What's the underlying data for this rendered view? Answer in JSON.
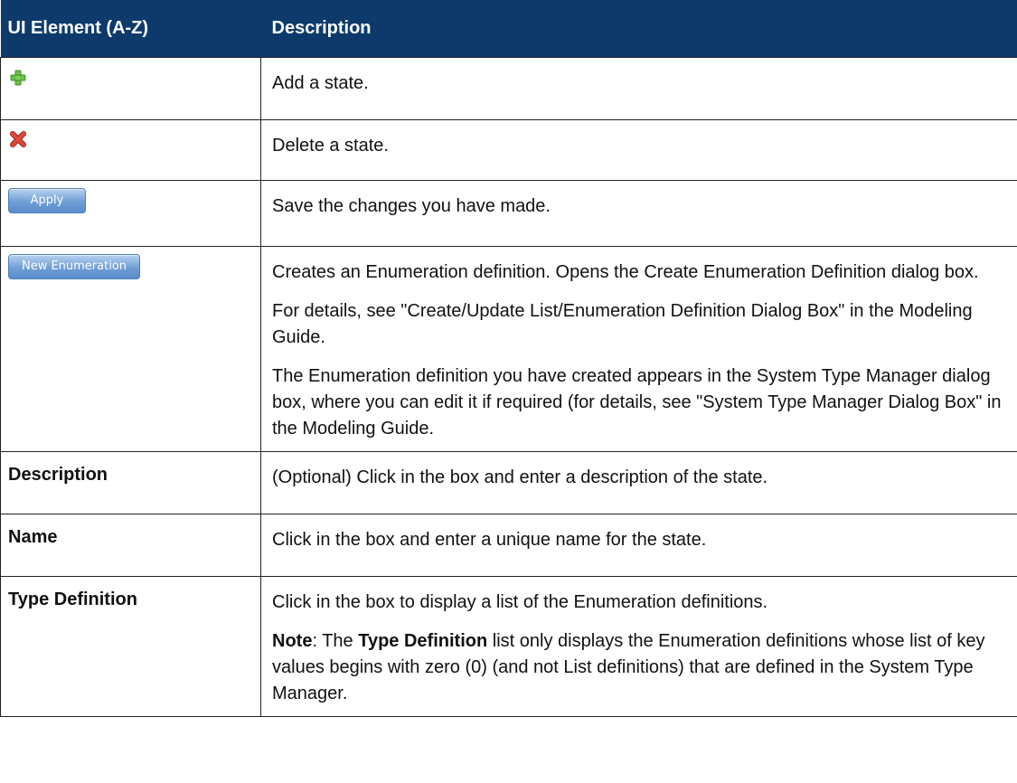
{
  "header": {
    "col1": "UI Element (A-Z)",
    "col2": "Description"
  },
  "rows": [
    {
      "icon": "add-plus-icon",
      "description": [
        "Add a state."
      ]
    },
    {
      "icon": "delete-x-icon",
      "description": [
        "Delete a state."
      ]
    },
    {
      "button": "Apply",
      "description": [
        "Save the changes you have made."
      ]
    },
    {
      "button": "New Enumeration",
      "description": [
        "Creates an Enumeration definition. Opens the Create Enumeration Definition dialog box.",
        "For details, see \"Create/Update List/Enumeration Definition Dialog Box\" in the Modeling Guide.",
        "The Enumeration definition you have created appears in the System Type Manager dialog box, where you can edit it if required (for details, see \"System Type Manager Dialog Box\" in the Modeling Guide."
      ]
    },
    {
      "element": "Description",
      "description": [
        "(Optional) Click in the box and enter a description of the state."
      ]
    },
    {
      "element": "Name",
      "description": [
        "Click in the box and enter a unique name for the state."
      ]
    },
    {
      "element": "Type Definition",
      "description": [
        "Click in the box to display a list of the Enumeration definitions."
      ],
      "note": {
        "label": "Note",
        "text1": ": The ",
        "strong": "Type Definition",
        "text2": " list only displays the Enumeration definitions whose list of key values begins with zero (0) (and not List definitions) that are defined in the System Type Manager."
      }
    }
  ],
  "colors": {
    "header_bg": "#0e3a6b",
    "header_text": "#ffffff",
    "plus_icon": "#6cc04a",
    "delete_icon": "#d9342b",
    "button_blue": "#6f9ed6"
  }
}
